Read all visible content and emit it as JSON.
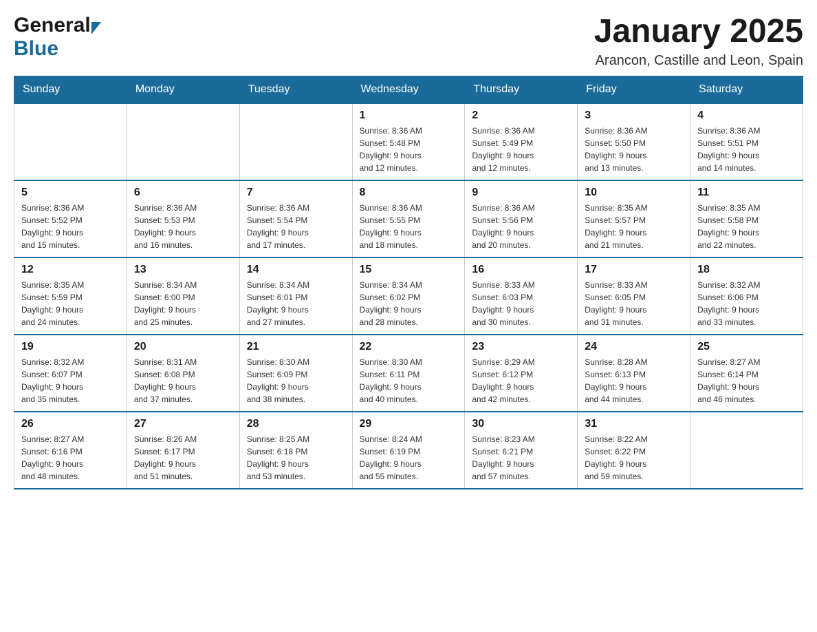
{
  "header": {
    "logo_general": "General",
    "logo_blue": "Blue",
    "month_year": "January 2025",
    "location": "Arancon, Castille and Leon, Spain"
  },
  "days_of_week": [
    "Sunday",
    "Monday",
    "Tuesday",
    "Wednesday",
    "Thursday",
    "Friday",
    "Saturday"
  ],
  "weeks": [
    [
      {
        "day": "",
        "info": ""
      },
      {
        "day": "",
        "info": ""
      },
      {
        "day": "",
        "info": ""
      },
      {
        "day": "1",
        "info": "Sunrise: 8:36 AM\nSunset: 5:48 PM\nDaylight: 9 hours\nand 12 minutes."
      },
      {
        "day": "2",
        "info": "Sunrise: 8:36 AM\nSunset: 5:49 PM\nDaylight: 9 hours\nand 12 minutes."
      },
      {
        "day": "3",
        "info": "Sunrise: 8:36 AM\nSunset: 5:50 PM\nDaylight: 9 hours\nand 13 minutes."
      },
      {
        "day": "4",
        "info": "Sunrise: 8:36 AM\nSunset: 5:51 PM\nDaylight: 9 hours\nand 14 minutes."
      }
    ],
    [
      {
        "day": "5",
        "info": "Sunrise: 8:36 AM\nSunset: 5:52 PM\nDaylight: 9 hours\nand 15 minutes."
      },
      {
        "day": "6",
        "info": "Sunrise: 8:36 AM\nSunset: 5:53 PM\nDaylight: 9 hours\nand 16 minutes."
      },
      {
        "day": "7",
        "info": "Sunrise: 8:36 AM\nSunset: 5:54 PM\nDaylight: 9 hours\nand 17 minutes."
      },
      {
        "day": "8",
        "info": "Sunrise: 8:36 AM\nSunset: 5:55 PM\nDaylight: 9 hours\nand 18 minutes."
      },
      {
        "day": "9",
        "info": "Sunrise: 8:36 AM\nSunset: 5:56 PM\nDaylight: 9 hours\nand 20 minutes."
      },
      {
        "day": "10",
        "info": "Sunrise: 8:35 AM\nSunset: 5:57 PM\nDaylight: 9 hours\nand 21 minutes."
      },
      {
        "day": "11",
        "info": "Sunrise: 8:35 AM\nSunset: 5:58 PM\nDaylight: 9 hours\nand 22 minutes."
      }
    ],
    [
      {
        "day": "12",
        "info": "Sunrise: 8:35 AM\nSunset: 5:59 PM\nDaylight: 9 hours\nand 24 minutes."
      },
      {
        "day": "13",
        "info": "Sunrise: 8:34 AM\nSunset: 6:00 PM\nDaylight: 9 hours\nand 25 minutes."
      },
      {
        "day": "14",
        "info": "Sunrise: 8:34 AM\nSunset: 6:01 PM\nDaylight: 9 hours\nand 27 minutes."
      },
      {
        "day": "15",
        "info": "Sunrise: 8:34 AM\nSunset: 6:02 PM\nDaylight: 9 hours\nand 28 minutes."
      },
      {
        "day": "16",
        "info": "Sunrise: 8:33 AM\nSunset: 6:03 PM\nDaylight: 9 hours\nand 30 minutes."
      },
      {
        "day": "17",
        "info": "Sunrise: 8:33 AM\nSunset: 6:05 PM\nDaylight: 9 hours\nand 31 minutes."
      },
      {
        "day": "18",
        "info": "Sunrise: 8:32 AM\nSunset: 6:06 PM\nDaylight: 9 hours\nand 33 minutes."
      }
    ],
    [
      {
        "day": "19",
        "info": "Sunrise: 8:32 AM\nSunset: 6:07 PM\nDaylight: 9 hours\nand 35 minutes."
      },
      {
        "day": "20",
        "info": "Sunrise: 8:31 AM\nSunset: 6:08 PM\nDaylight: 9 hours\nand 37 minutes."
      },
      {
        "day": "21",
        "info": "Sunrise: 8:30 AM\nSunset: 6:09 PM\nDaylight: 9 hours\nand 38 minutes."
      },
      {
        "day": "22",
        "info": "Sunrise: 8:30 AM\nSunset: 6:11 PM\nDaylight: 9 hours\nand 40 minutes."
      },
      {
        "day": "23",
        "info": "Sunrise: 8:29 AM\nSunset: 6:12 PM\nDaylight: 9 hours\nand 42 minutes."
      },
      {
        "day": "24",
        "info": "Sunrise: 8:28 AM\nSunset: 6:13 PM\nDaylight: 9 hours\nand 44 minutes."
      },
      {
        "day": "25",
        "info": "Sunrise: 8:27 AM\nSunset: 6:14 PM\nDaylight: 9 hours\nand 46 minutes."
      }
    ],
    [
      {
        "day": "26",
        "info": "Sunrise: 8:27 AM\nSunset: 6:16 PM\nDaylight: 9 hours\nand 48 minutes."
      },
      {
        "day": "27",
        "info": "Sunrise: 8:26 AM\nSunset: 6:17 PM\nDaylight: 9 hours\nand 51 minutes."
      },
      {
        "day": "28",
        "info": "Sunrise: 8:25 AM\nSunset: 6:18 PM\nDaylight: 9 hours\nand 53 minutes."
      },
      {
        "day": "29",
        "info": "Sunrise: 8:24 AM\nSunset: 6:19 PM\nDaylight: 9 hours\nand 55 minutes."
      },
      {
        "day": "30",
        "info": "Sunrise: 8:23 AM\nSunset: 6:21 PM\nDaylight: 9 hours\nand 57 minutes."
      },
      {
        "day": "31",
        "info": "Sunrise: 8:22 AM\nSunset: 6:22 PM\nDaylight: 9 hours\nand 59 minutes."
      },
      {
        "day": "",
        "info": ""
      }
    ]
  ]
}
